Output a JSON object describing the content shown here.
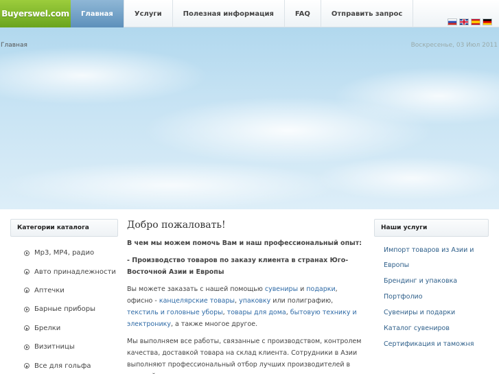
{
  "logo": "Buyerswel.com",
  "nav": [
    {
      "label": "Главная",
      "active": true
    },
    {
      "label": "Услуги",
      "active": false
    },
    {
      "label": "Полезная информация",
      "active": false
    },
    {
      "label": "FAQ",
      "active": false
    },
    {
      "label": "Отправить запрос",
      "active": false
    }
  ],
  "flags": [
    "flag-ru-icon",
    "flag-uk-icon",
    "flag-es-icon",
    "flag-de-icon"
  ],
  "breadcrumb": "Главная",
  "date": "Воскресенье, 03 Июл 2011",
  "left": {
    "title": "Категории каталога",
    "items": [
      "Mp3, MP4, радио",
      "Авто принадлежности",
      "Аптечки",
      "Барные приборы",
      "Брелки",
      "Визитницы",
      "Все для гольфа"
    ]
  },
  "main": {
    "heading": "Добро пожаловать!",
    "intro": "В чем мы можем помочь Вам и наш профессиональный опыт:",
    "point": "- Производство  товаров  по заказу клиента в странах  Юго-Восточной Азии и  Европы",
    "p1": {
      "t1": "Вы можете заказать с нашей помощью ",
      "l1": "сувениры",
      "t2": " и ",
      "l2": "подарки",
      "t3": ", офисно - ",
      "l3": "канцелярские товары",
      "t4": ", ",
      "l4": "упаковку",
      "t5": " или полиграфию, ",
      "l5": "текстиль и головные уборы",
      "t6": ", ",
      "l6": "товары для дома",
      "t7": ", ",
      "l7": "бытовую технику и электронику",
      "t8": ", а также многое другое."
    },
    "p2": "Мы  выполняем все работы, связанные с производством, контролем качества, доставкой товара на склад клиента. Сотрудники в Азии выполняют профессиональный отбор лучших производителей в искомой"
  },
  "right": {
    "title": "Наши услуги",
    "items": [
      "Импорт товаров из Азии и Европы",
      "Брендинг и упаковка",
      "Портфолио",
      "Сувениры и подарки",
      "Каталог сувениров",
      "Сертификация и таможня"
    ]
  }
}
